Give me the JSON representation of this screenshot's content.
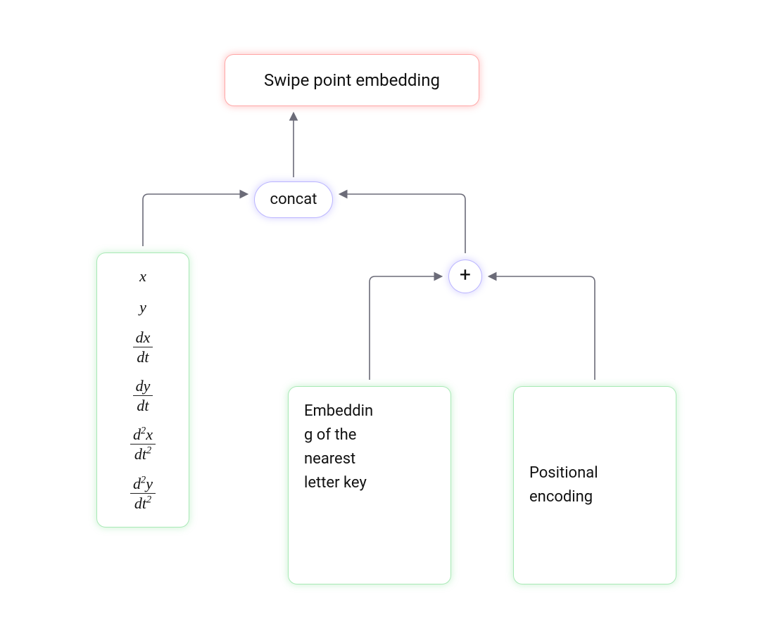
{
  "diagram": {
    "output_label": "Swipe point embedding",
    "concat_label": "concat",
    "plus_label": "+",
    "features": {
      "x": "x",
      "y": "y",
      "dx_num": "dx",
      "dy_num": "dy",
      "d2x_num": "d²x",
      "d2y_num": "d²y",
      "dt": "dt",
      "dt2": "dt²"
    },
    "nearest_key_embed": "Embedding of the nearest letter key",
    "positional_encoding": "Positional encoding"
  },
  "colors": {
    "output_glow": "#ff7a7a",
    "op_glow": "#8b80ff",
    "input_glow": "#7fe09a",
    "arrow": "#6b6b78"
  }
}
